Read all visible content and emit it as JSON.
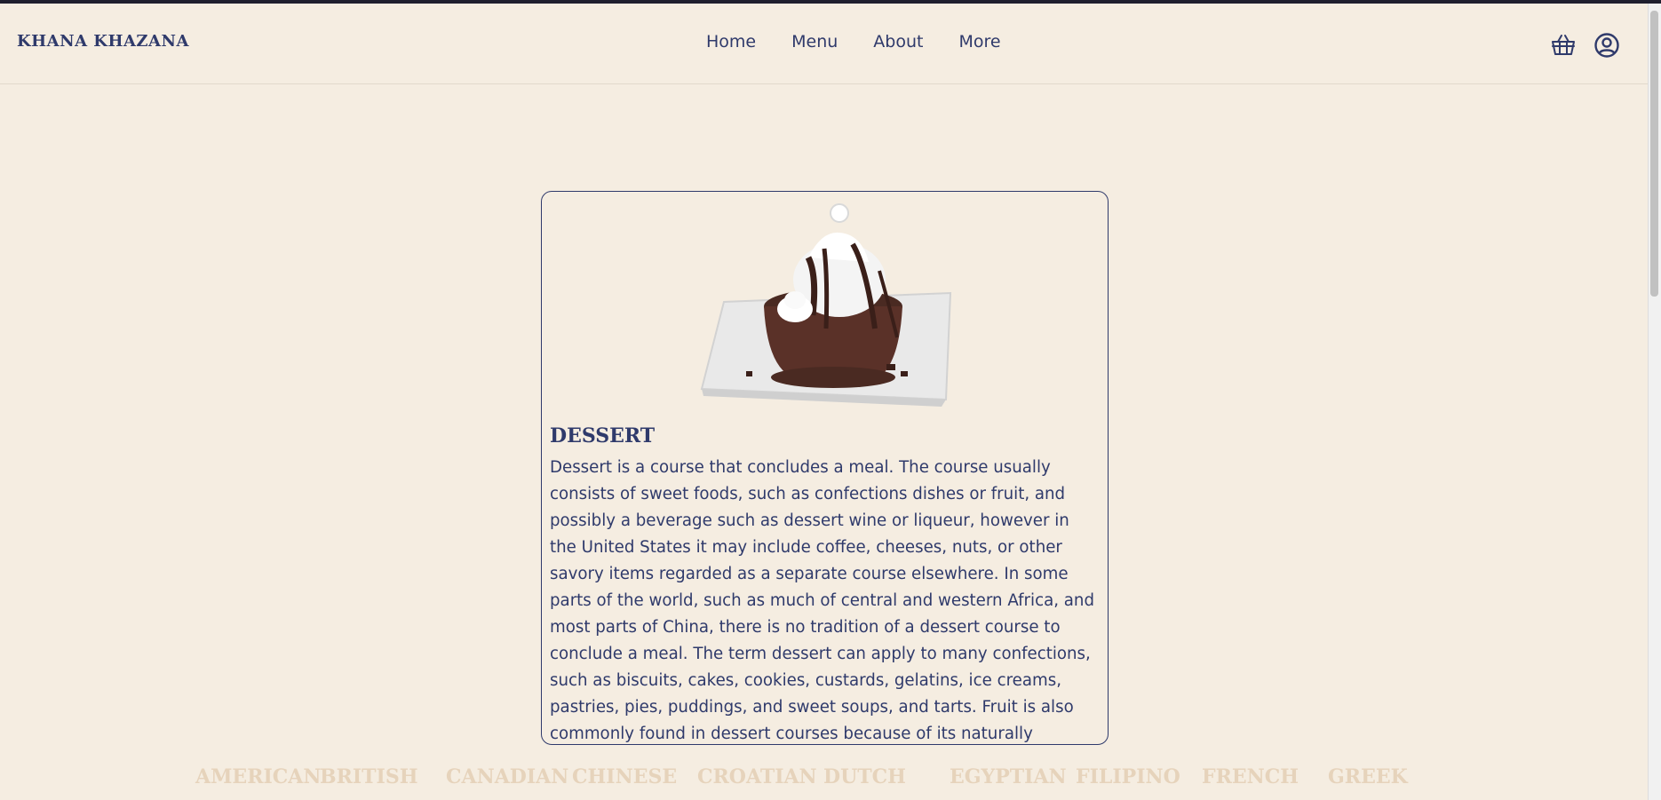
{
  "header": {
    "brand": "KHANA KHAZANA",
    "nav": [
      "Home",
      "Menu",
      "About",
      "More"
    ],
    "cart_icon": "basket-icon",
    "account_icon": "user-circle-icon"
  },
  "card": {
    "image": "chocolate-lava-cake-with-ice-cream",
    "title": "DESSERT",
    "text": "Dessert is a course that concludes a meal. The course usually consists of sweet foods, such as confections dishes or fruit, and possibly a beverage such as dessert wine or liqueur, however in the United States it may include coffee, cheeses, nuts, or other savory items regarded as a separate course elsewhere. In some parts of the world, such as much of central and western Africa, and most parts of China, there is no tradition of a dessert course to conclude a meal. The term dessert can apply to many confections, such as biscuits, cakes, cookies, custards, gelatins, ice creams, pastries, pies, puddings, and sweet soups, and tarts. Fruit is also commonly found in dessert courses because of its naturally occurring sweetness. Some cultures sweeten"
  },
  "cuisines": [
    "AMERICAN",
    "BRITISH",
    "CANADIAN",
    "CHINESE",
    "CROATIAN",
    "DUTCH",
    "EGYPTIAN",
    "FILIPINO",
    "FRENCH",
    "GREEK"
  ],
  "colors": {
    "background": "#f5ede1",
    "text": "#2f3a6b",
    "cuisine_text": "#e6d3bb"
  }
}
